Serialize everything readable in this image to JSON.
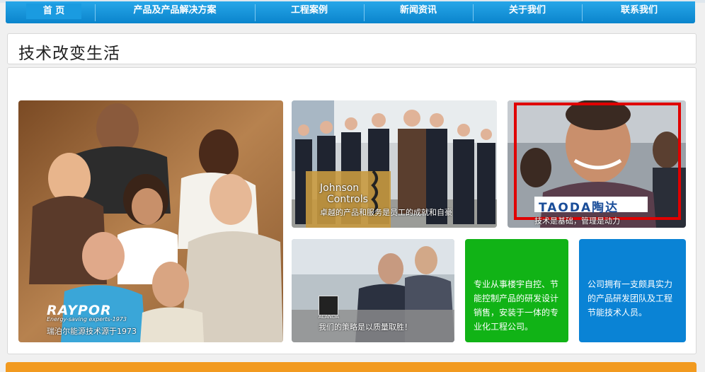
{
  "nav": {
    "items": [
      {
        "label": "首 页"
      },
      {
        "label": "产品及产品解决方案"
      },
      {
        "label": "工程案例"
      },
      {
        "label": "新闻资讯"
      },
      {
        "label": "关于我们"
      },
      {
        "label": "联系我们"
      }
    ]
  },
  "page": {
    "title": "技术改变生活"
  },
  "tiles": {
    "raypor": {
      "brand": "RAYPOR",
      "tagline": "Energy-saving experts-1973",
      "caption": "瑞泊尔能源技术源于1973"
    },
    "johnson": {
      "brand_line1": "Johnson",
      "brand_line2": "Controls",
      "caption": "卓越的产品和服务是员工的成就和自豪"
    },
    "taoda": {
      "brand": "TAODA陶达",
      "caption": "技术是基础，管理是动力"
    },
    "alanda": {
      "brand": "ALANDA",
      "caption": "我们的策略是以质量取胜！"
    },
    "green_info": {
      "text": "专业从事楼宇自控、节能控制产品的研发设计销售，安装于一体的专业化工程公司。"
    },
    "blue_info": {
      "text": "公司拥有一支颇具实力的产品研发团队及工程节能技术人员。"
    }
  },
  "colors": {
    "nav_blue": "#0a84cc",
    "green_tile": "#11b316",
    "blue_tile": "#0a83d5",
    "highlight_border": "#e00000",
    "footer_orange": "#f29a1f"
  }
}
